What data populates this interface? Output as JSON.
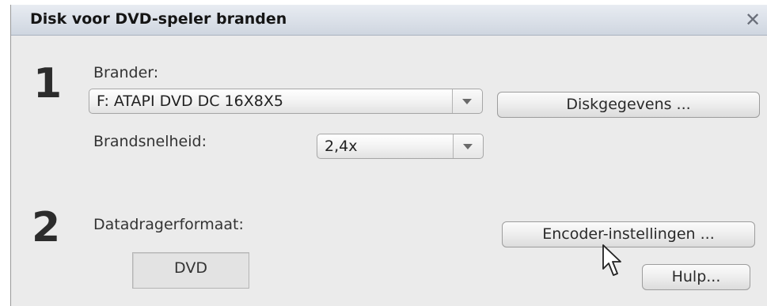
{
  "dialog": {
    "title": "Disk voor DVD-speler branden",
    "close_symbol": "✕"
  },
  "step1": {
    "number": "1",
    "burner_label": "Brander:",
    "burner_value": "F: ATAPI DVD DC 16X8X5",
    "disk_info_button": "Diskgegevens ...",
    "speed_label": "Brandsnelheid:",
    "speed_value": "2,4x"
  },
  "step2": {
    "number": "2",
    "media_format_label": "Datadragerformaat:",
    "media_format_value": "DVD",
    "encoder_button": "Encoder-instellingen ...",
    "help_button": "Hulp..."
  },
  "icons": {
    "dropdown": "chevron-down-icon",
    "close": "close-icon",
    "cursor": "mouse-pointer-icon"
  },
  "colors": {
    "dialog_bg": "#ebebeb",
    "titlebar_top": "#e8ecf2",
    "titlebar_bottom": "#cfd6e0"
  }
}
